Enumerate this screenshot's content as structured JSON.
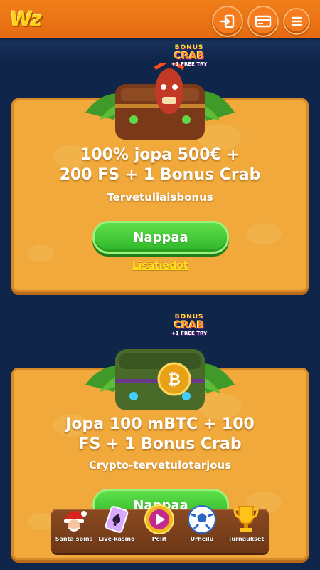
{
  "header": {
    "logo": "Wz",
    "icons": [
      "login-icon",
      "wallet-card-icon",
      "menu-icon"
    ]
  },
  "offers": [
    {
      "badge_top": "BONUS",
      "badge_main": "CRAB",
      "badge_bottom": "+1 FREE TRY",
      "title_line1": "100% jopa 500€ +",
      "title_line2": "200 FS + 1 Bonus Crab",
      "subtitle": "Tervetuliaisbonus",
      "cta": "Nappaa",
      "more": "Lisätiedot"
    },
    {
      "badge_top": "BONUS",
      "badge_main": "CRAB",
      "badge_bottom": "+1 FREE TRY",
      "title_line1": "Jopa 100 mBTC + 100",
      "title_line2": "FS + 1 Bonus Crab",
      "subtitle": "Crypto-tervetulotarjous",
      "cta": "Nappaa"
    }
  ],
  "dock": [
    {
      "label": "Santa spins",
      "icon": "santa-icon"
    },
    {
      "label": "Live-kasino",
      "icon": "card-spade-icon"
    },
    {
      "label": "Pelit",
      "icon": "play-icon"
    },
    {
      "label": "Urheilu",
      "icon": "soccer-ball-icon"
    },
    {
      "label": "Turnaukset",
      "icon": "trophy-icon"
    }
  ],
  "colors": {
    "header": "#f07f1a",
    "background": "#10254a",
    "card": "#f0a93a",
    "cta": "#3fc936",
    "link": "#ffe21a"
  }
}
